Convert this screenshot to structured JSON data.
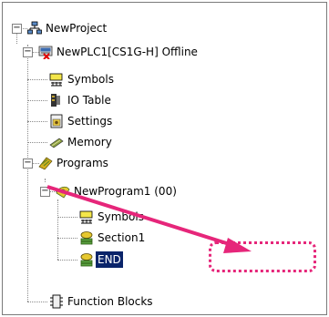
{
  "tree": {
    "project": {
      "label": "NewProject",
      "icon": "network-project-icon"
    },
    "plc": {
      "label": "NewPLC1[CS1G-H] Offline",
      "icon": "plc-offline-icon"
    },
    "symbols": {
      "label": "Symbols",
      "icon": "symbols-icon"
    },
    "io_table": {
      "label": "IO Table",
      "icon": "io-table-icon"
    },
    "settings": {
      "label": "Settings",
      "icon": "settings-icon"
    },
    "memory": {
      "label": "Memory",
      "icon": "memory-icon"
    },
    "programs": {
      "label": "Programs",
      "icon": "programs-icon"
    },
    "program1": {
      "label": "NewProgram1 (00)",
      "icon": "program-icon"
    },
    "prog_symbols": {
      "label": "Symbols",
      "icon": "symbols-icon"
    },
    "section1": {
      "label": "Section1",
      "icon": "section-icon"
    },
    "end": {
      "label": "END",
      "icon": "section-icon",
      "selected": true
    },
    "function_blocks": {
      "label": "Function Blocks",
      "icon": "function-block-icon"
    }
  },
  "expanders": {
    "collapse_symbol": "−"
  },
  "annotation": {
    "color": "#e6267a",
    "target": "END"
  }
}
